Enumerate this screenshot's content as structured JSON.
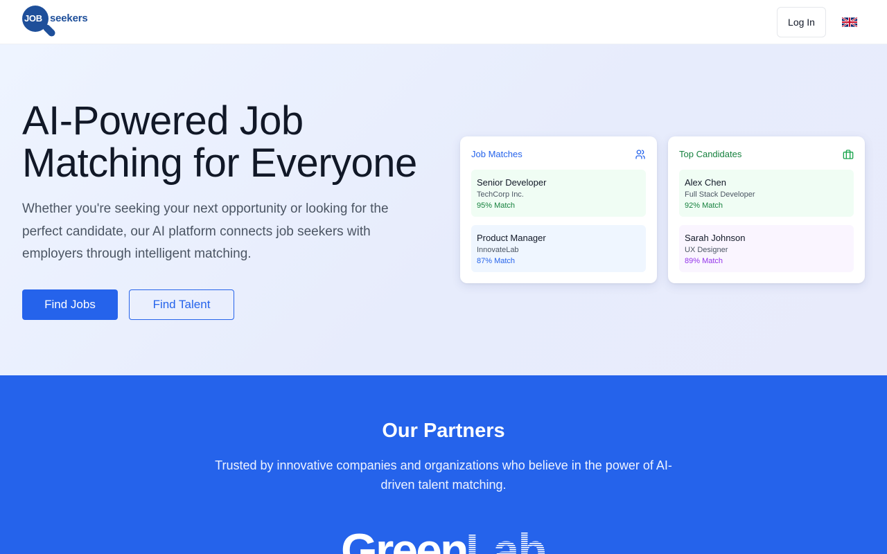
{
  "header": {
    "logo": {
      "job": "JOB",
      "seekers": "seekers"
    },
    "login_label": "Log In",
    "language_icon": "uk-flag-icon"
  },
  "hero": {
    "title": "AI-Powered Job Matching for Everyone",
    "subtitle": "Whether you're seeking your next opportunity or looking for the perfect candidate, our AI platform connects job seekers with employers through intelligent matching.",
    "primary_button": "Find Jobs",
    "secondary_button": "Find Talent",
    "cards": {
      "job_matches": {
        "title": "Job Matches",
        "icon": "users-icon",
        "items": [
          {
            "name": "Senior Developer",
            "sub": "TechCorp Inc.",
            "match": "95% Match"
          },
          {
            "name": "Product Manager",
            "sub": "InnovateLab",
            "match": "87% Match"
          }
        ]
      },
      "top_candidates": {
        "title": "Top Candidates",
        "icon": "briefcase-icon",
        "items": [
          {
            "name": "Alex Chen",
            "sub": "Full Stack Developer",
            "match": "92% Match"
          },
          {
            "name": "Sarah Johnson",
            "sub": "UX Designer",
            "match": "89% Match"
          }
        ]
      }
    }
  },
  "partners": {
    "title": "Our Partners",
    "subtitle": "Trusted by innovative companies and organizations who believe in the power of AI-driven talent matching.",
    "logo_text": {
      "green": "Green",
      "lab": "Lab"
    }
  },
  "colors": {
    "brand_blue": "#2563eb",
    "logo_navy": "#1e4f9a",
    "green_bg": "#f0fdf4",
    "green_text": "#15803d",
    "blue_bg": "#eff6ff",
    "blue_text": "#2563eb",
    "purple_bg": "#faf5ff",
    "purple_text": "#9333ea"
  }
}
